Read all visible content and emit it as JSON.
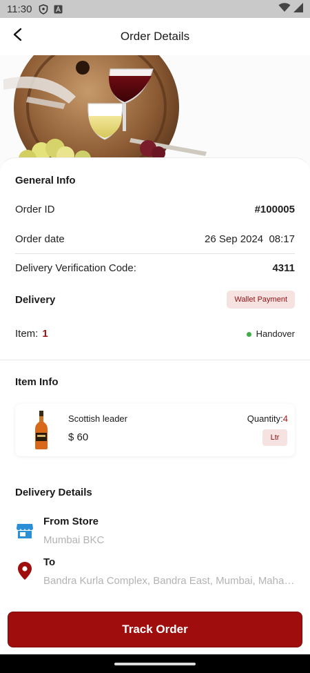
{
  "status_bar": {
    "time": "11:30",
    "icons": [
      "shield-icon",
      "a-icon",
      "wifi-icon",
      "signal-icon"
    ]
  },
  "header": {
    "title": "Order Details",
    "back_icon": "back-arrow-icon"
  },
  "general_info": {
    "title": "General Info",
    "order_id_label": "Order ID",
    "order_id_value": "#100005",
    "order_date_label": "Order date",
    "order_date_value": "26 Sep 2024  08:17",
    "verification_label": "Delivery Verification Code:",
    "verification_value": "4311",
    "delivery_label": "Delivery",
    "payment_badge": "Wallet Payment",
    "item_label": "Item:",
    "item_count": "1",
    "status_text": "Handover",
    "status_color": "#3fae4a"
  },
  "item_info": {
    "title": "Item Info",
    "product_name": "Scottish leader",
    "price": "$ 60",
    "quantity_label": "Quantity:",
    "quantity_value": "4",
    "unit": "Ltr"
  },
  "delivery_details": {
    "title": "Delivery Details",
    "from_label": "From Store",
    "from_value": "Mumbai BKC",
    "from_icon": "store-icon",
    "to_label": "To",
    "to_value": "Bandra Kurla Complex, Bandra East, Mumbai, Maharashtra",
    "to_icon": "location-pin-icon"
  },
  "actions": {
    "track_order_label": "Track Order"
  },
  "colors": {
    "accent": "#a00d0d",
    "badge_bg": "#f7e2e2",
    "store_icon": "#2b8fd8"
  }
}
